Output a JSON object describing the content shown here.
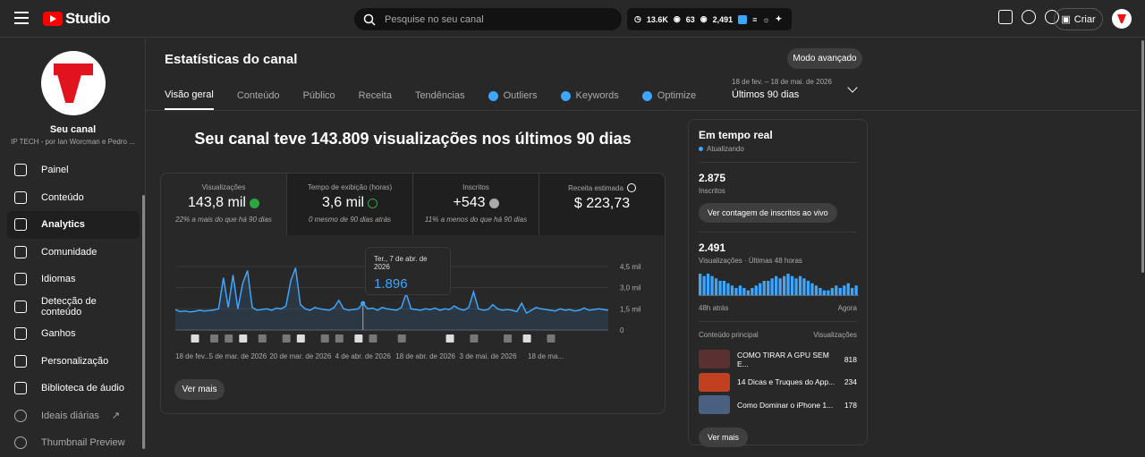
{
  "header": {
    "logo_text": "Studio",
    "search_placeholder": "Pesquise no seu canal",
    "stats": {
      "subs": "13.6K",
      "a": "63",
      "views": "2,491"
    },
    "create_label": "Criar"
  },
  "sidebar": {
    "channel_name": "Seu canal",
    "channel_sub": "IP TECH - por Ian Worcman e Pedro ...",
    "items": [
      {
        "label": "Painel",
        "icon": "dashboard-icon"
      },
      {
        "label": "Conteúdo",
        "icon": "content-icon"
      },
      {
        "label": "Analytics",
        "icon": "analytics-icon"
      },
      {
        "label": "Comunidade",
        "icon": "community-icon"
      },
      {
        "label": "Idiomas",
        "icon": "subtitles-icon"
      },
      {
        "label": "Detecção de conteúdo",
        "icon": "copyright-icon"
      },
      {
        "label": "Ganhos",
        "icon": "earn-icon"
      },
      {
        "label": "Personalização",
        "icon": "magic-wand-icon"
      },
      {
        "label": "Biblioteca de áudio",
        "icon": "audio-library-icon"
      },
      {
        "label": "Ideais diárias",
        "icon": "extension-icon"
      },
      {
        "label": "Thumbnail Preview",
        "icon": "extension-icon"
      }
    ]
  },
  "page": {
    "title": "Estatísticas do canal",
    "advanced_mode": "Modo avançado",
    "tabs": [
      "Visão geral",
      "Conteúdo",
      "Público",
      "Receita",
      "Tendências",
      "Outliers",
      "Keywords",
      "Optimize"
    ],
    "range_dates": "18 de fev. – 18 de mai. de 2026",
    "range_label": "Últimos 90 dias",
    "headline": "Seu canal teve 143.809 visualizações nos últimos 90 dias"
  },
  "metrics": [
    {
      "label": "Visualizações",
      "value": "143,8 mil",
      "note": "22% a mais do que há 90 dias"
    },
    {
      "label": "Tempo de exibição (horas)",
      "value": "3,6 mil",
      "note": "0 mesmo de 90 dias atrás"
    },
    {
      "label": "Inscritos",
      "value": "+543",
      "note": "11% a menos do que há 90 dias"
    },
    {
      "label": "Receita estimada",
      "value": "$ 223,73",
      "note": ""
    }
  ],
  "tooltip": {
    "date": "Ter., 7 de abr. de 2026",
    "value": "1.896"
  },
  "see_more": "Ver mais",
  "chart_data": {
    "type": "area",
    "y_ticks": [
      "4,5 mil",
      "3,0 mil",
      "1,5 mil",
      "0"
    ],
    "ylim": [
      0,
      4500
    ],
    "x_tick_labels": [
      "18 de fev...",
      "5 de mar. de 2026",
      "20 de mar. de 2026",
      "4 de abr. de 2026",
      "18 de abr. de 2026",
      "3 de mai. de 2026",
      "18 de ma..."
    ],
    "values": [
      1450,
      1300,
      1350,
      1280,
      1320,
      1400,
      1350,
      1380,
      1420,
      1500,
      3700,
      1600,
      3900,
      1500,
      3300,
      4200,
      1600,
      1400,
      1450,
      1500,
      1400,
      1550,
      1500,
      1700,
      3500,
      4400,
      1800,
      1500,
      1400,
      1600,
      1500,
      1450,
      1400,
      1600,
      2100,
      1500,
      1400,
      1450,
      1500,
      1896,
      1500,
      1550,
      1400,
      1600,
      1500,
      1450,
      1400,
      1600,
      2600,
      1500,
      1450,
      1400,
      1500,
      1450,
      1550,
      1400,
      1500,
      1450,
      1700,
      1500,
      1400,
      1600,
      2700,
      1500,
      1400,
      1450,
      1800,
      1500,
      1400,
      1450,
      1400,
      1300,
      1900,
      1200,
      1400,
      1600,
      1500,
      1450,
      1400,
      1350,
      1500,
      1400,
      1450,
      1350,
      1400,
      1550,
      1400,
      1450,
      1500,
      1450,
      1400
    ]
  },
  "realtime": {
    "title": "Em tempo real",
    "updating": "Atualizando",
    "subs_value": "2.875",
    "subs_label": "Inscritos",
    "subs_button": "Ver contagem de inscritos ao vivo",
    "views_value": "2.491",
    "views_label": "Visualizações · Últimas 48 horas",
    "ax_left": "48h atrás",
    "ax_right": "Agora",
    "bars": [
      9,
      8,
      9,
      8,
      7,
      6,
      6,
      5,
      4,
      3,
      4,
      3,
      2,
      3,
      4,
      5,
      6,
      6,
      7,
      8,
      7,
      8,
      9,
      8,
      7,
      8,
      7,
      6,
      5,
      4,
      3,
      2,
      2,
      3,
      4,
      3,
      4,
      5,
      3,
      4
    ],
    "top_header": "Conteúdo principal",
    "top_col": "Visualizações",
    "videos": [
      {
        "title": "COMO TIRAR A GPU SEM E...",
        "views": "818",
        "thumb": "#5a3030"
      },
      {
        "title": "14 Dicas e Truques do App...",
        "views": "234",
        "thumb": "#c04020"
      },
      {
        "title": "Como Dominar o iPhone 1...",
        "views": "178",
        "thumb": "#4a6080"
      }
    ],
    "see_more": "Ver mais"
  },
  "colors": {
    "accent": "#3ea6ff",
    "up": "#2ba640",
    "brand": "#ff0000"
  }
}
